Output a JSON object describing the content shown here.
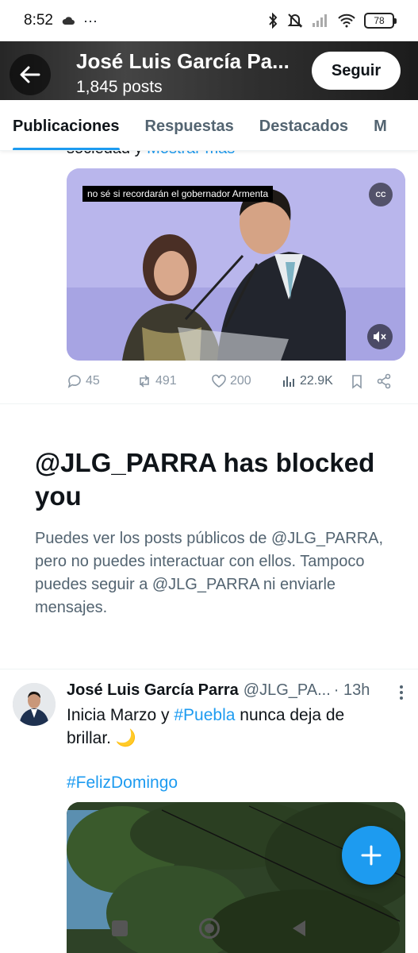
{
  "status_bar": {
    "time": "8:52",
    "more": "···",
    "battery": "78"
  },
  "header": {
    "title": "José Luis García Pa...",
    "posts_count": "1,845 posts",
    "follow_label": "Seguir"
  },
  "tabs": [
    {
      "label": "Publicaciones",
      "active": true
    },
    {
      "label": "Respuestas",
      "active": false
    },
    {
      "label": "Destacados",
      "active": false
    },
    {
      "label": "M",
      "active": false
    }
  ],
  "video_post": {
    "text_prefix": "sociedad y ",
    "show_more": "Mostrar más",
    "caption": "no sé si recordarán el gobernador Armenta",
    "cc_label": "CC",
    "replies": "45",
    "reposts": "491",
    "likes": "200",
    "views": "22.9K"
  },
  "blocked": {
    "title": "@JLG_PARRA has blocked you",
    "description": "Puedes ver los posts públicos de @JLG_PARRA, pero no puedes interactuar con ellos. Tampoco puedes seguir a @JLG_PARRA ni enviarle mensajes."
  },
  "post2": {
    "name": "José Luis García Parra",
    "handle": "@JLG_PA...",
    "time": "· 13h",
    "text_a": "Inicia Marzo y ",
    "hashtag1": "#Puebla",
    "text_b": " nunca deja de brillar. 🌙",
    "hashtag2": "#FelizDomingo"
  },
  "colors": {
    "accent": "#1d9bf0",
    "text_primary": "#0f1419",
    "text_secondary": "#536471"
  }
}
